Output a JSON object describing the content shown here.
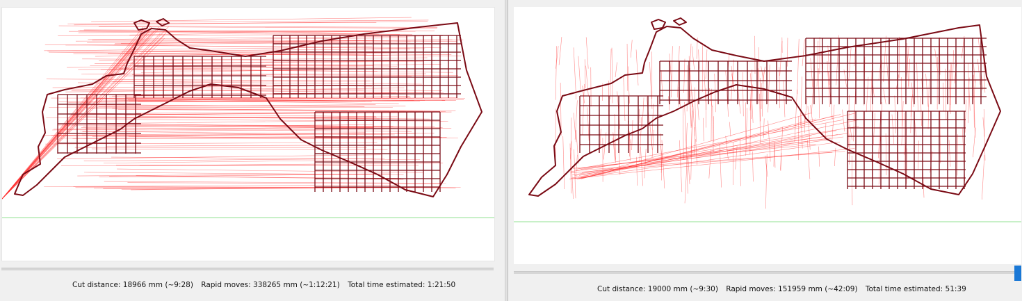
{
  "left_panel": {
    "status": {
      "cut_distance": "Cut distance: 18966 mm (~9:28)",
      "rapid_moves": "Rapid moves: 338265 mm (~1:12:21)",
      "total_time": "Total time estimated: 1:21:50"
    }
  },
  "right_panel": {
    "status": {
      "cut_distance": "Cut distance: 19000 mm (~9:30)",
      "rapid_moves": "Rapid moves: 151959 mm (~42:09)",
      "total_time": "Total time estimated: 51:39"
    }
  },
  "colors": {
    "map_stroke": "#7a0a14",
    "rapid_line": "#ff2a2a",
    "baseline": "#a8e6a8",
    "scroll_accent": "#1a78d6"
  }
}
